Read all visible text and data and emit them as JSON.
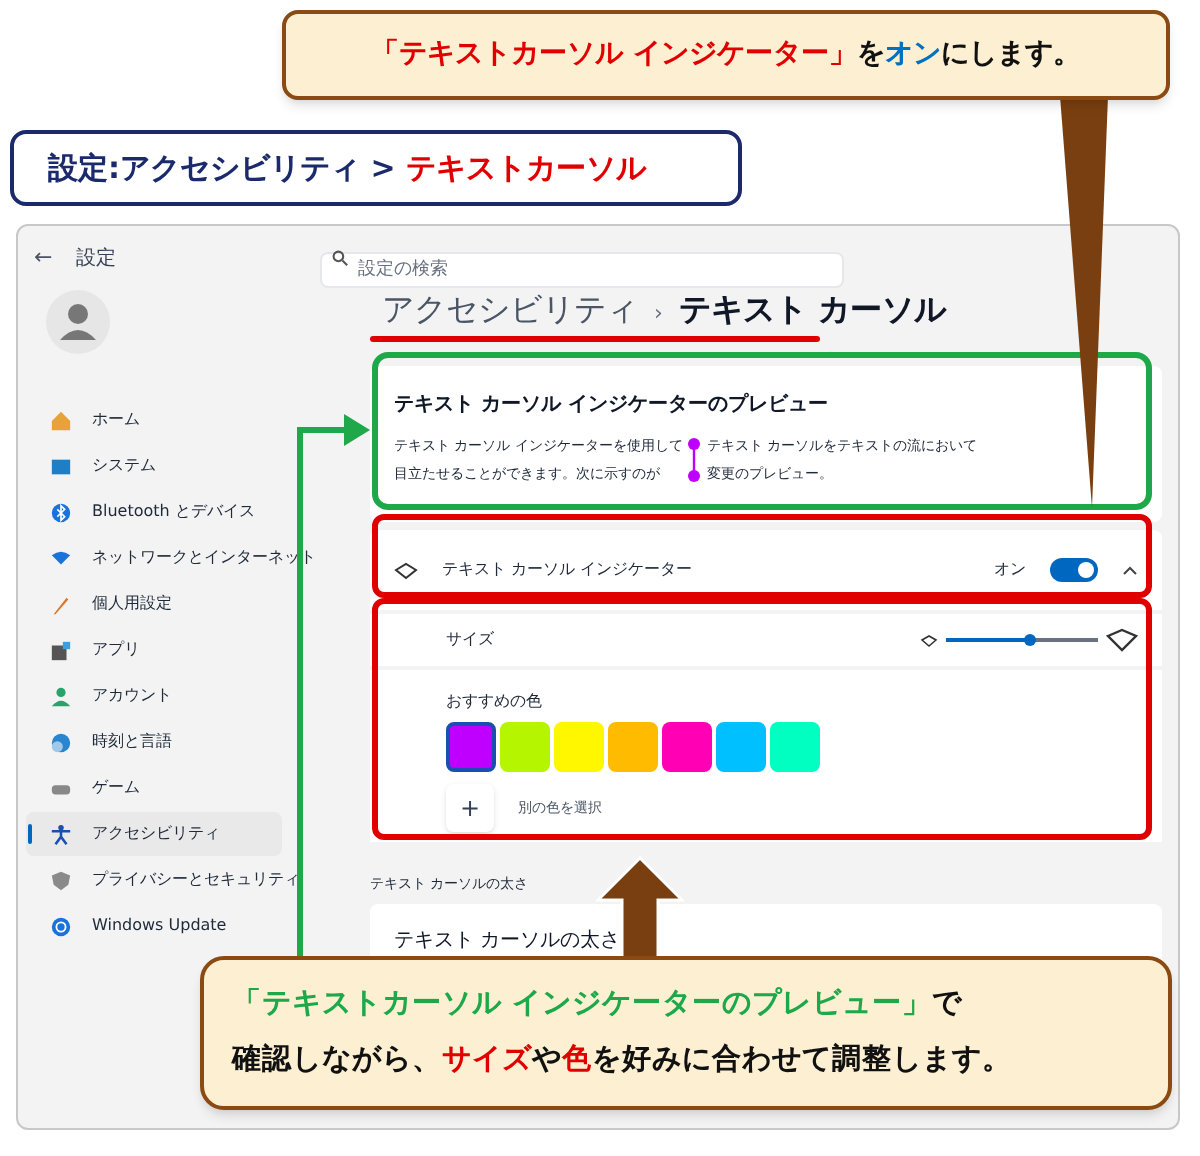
{
  "window": {
    "back": "←",
    "title": "設定",
    "search": {
      "placeholder": "設定の検索"
    }
  },
  "sidebar": {
    "items": [
      {
        "label": "ホーム",
        "selected": false
      },
      {
        "label": "システム",
        "selected": false
      },
      {
        "label": "Bluetooth とデバイス",
        "selected": false
      },
      {
        "label": "ネットワークとインターネット",
        "selected": false
      },
      {
        "label": "個人用設定",
        "selected": false
      },
      {
        "label": "アプリ",
        "selected": false
      },
      {
        "label": "アカウント",
        "selected": false
      },
      {
        "label": "時刻と言語",
        "selected": false
      },
      {
        "label": "ゲーム",
        "selected": false
      },
      {
        "label": "アクセシビリティ",
        "selected": true
      },
      {
        "label": "プライバシーとセキュリティ",
        "selected": false
      },
      {
        "label": "Windows Update",
        "selected": false
      }
    ]
  },
  "breadcrumb": {
    "parent": "アクセシビリティ",
    "separator": "›",
    "current": "テキスト カーソル"
  },
  "preview": {
    "title": "テキスト カーソル インジケーターのプレビュー",
    "lines": [
      [
        "テキスト カーソル インジケーターを使用して",
        "テキスト カーソルをテキストの流において"
      ],
      [
        "目立たせることができます。次に示すのが",
        "変更のプレビュー。"
      ]
    ]
  },
  "indicator": {
    "label": "テキスト カーソル インジケーター",
    "state_text": "オン",
    "on": true,
    "expanded": true
  },
  "size": {
    "label": "サイズ",
    "level": 0.55
  },
  "colors": {
    "label": "おすすめの色",
    "swatches": [
      {
        "color": "#c000ff",
        "selected": true
      },
      {
        "color": "#b5f500",
        "selected": false
      },
      {
        "color": "#fff700",
        "selected": false
      },
      {
        "color": "#ffbb00",
        "selected": false
      },
      {
        "color": "#ff00b4",
        "selected": false
      },
      {
        "color": "#00c0ff",
        "selected": false
      },
      {
        "color": "#00ffc0",
        "selected": false
      }
    ],
    "custom_button": "+",
    "custom_label": "別の色を選択"
  },
  "thickness": {
    "heading": "テキスト カーソルの太さ",
    "card_title": "テキスト カーソルの太さ"
  },
  "annotations": {
    "top_callout": [
      {
        "text": "「テキストカーソル インジケーター」",
        "color": "#e00000"
      },
      {
        "text": "を",
        "color": "#111111"
      },
      {
        "text": "オン",
        "color": "#0070c0"
      },
      {
        "text": "にします。",
        "color": "#111111"
      }
    ],
    "title_box": [
      {
        "text": "設定:アクセシビリティ > ",
        "color": "#1a2a6c"
      },
      {
        "text": "テキストカーソル",
        "color": "#e00000"
      }
    ],
    "bottom_callout": [
      [
        {
          "text": "「テキストカーソル インジケーターのプレビュー」",
          "color": "#1ea84a"
        },
        {
          "text": "で",
          "color": "#111111"
        }
      ],
      [
        {
          "text": "確認しながら、",
          "color": "#111111"
        },
        {
          "text": "サイズ",
          "color": "#e00000"
        },
        {
          "text": "や",
          "color": "#111111"
        },
        {
          "text": "色",
          "color": "#e00000"
        },
        {
          "text": "を好みに合わせて調整します。",
          "color": "#111111"
        }
      ]
    ]
  }
}
